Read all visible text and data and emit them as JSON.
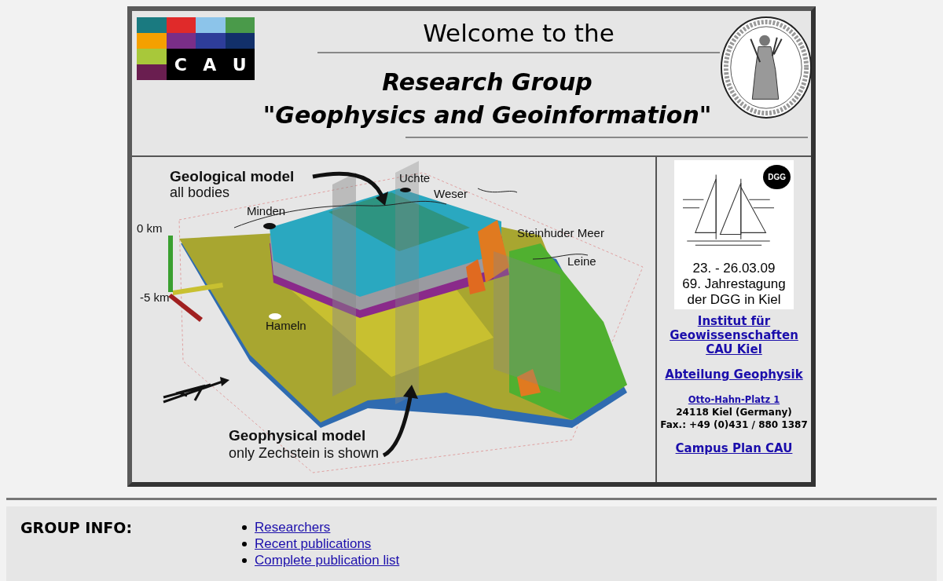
{
  "header": {
    "logo_letters": [
      "C",
      "A",
      "U"
    ],
    "welcome": "Welcome to the",
    "title_lines": [
      "Research Group",
      "\"Geophysics and Geoinformation\""
    ]
  },
  "model_image": {
    "labels": [
      {
        "kind": "heading",
        "text": "Geological model"
      },
      {
        "kind": "caption",
        "text": "all bodies"
      },
      {
        "kind": "place",
        "text": "Uchte"
      },
      {
        "kind": "place",
        "text": "Weser"
      },
      {
        "kind": "place",
        "text": "Minden"
      },
      {
        "kind": "axis",
        "text": "0 km"
      },
      {
        "kind": "place",
        "text": "Steinhuder Meer"
      },
      {
        "kind": "place",
        "text": "Leine"
      },
      {
        "kind": "axis",
        "text": "-5 km"
      },
      {
        "kind": "place",
        "text": "Hameln"
      },
      {
        "kind": "heading",
        "text": "Geophysical model"
      },
      {
        "kind": "caption",
        "text": "only Zechstein is shown"
      }
    ]
  },
  "sidebar": {
    "poster": {
      "logo_text": "DGG",
      "lines": [
        "23. - 26.03.09",
        "69. Jahrestagung",
        "der DGG in Kiel"
      ]
    },
    "items": [
      {
        "kind": "link",
        "text": "Institut für Geowissenschaften CAU Kiel"
      },
      {
        "kind": "link",
        "text": "Abteilung Geophysik"
      },
      {
        "kind": "small-link",
        "text": "Otto-Hahn-Platz 1"
      },
      {
        "kind": "address",
        "text": "24118 Kiel (Germany)"
      },
      {
        "kind": "address",
        "text": "Fax.: +49 (0)431 / 880 1387"
      },
      {
        "kind": "link",
        "text": "Campus Plan CAU"
      }
    ]
  },
  "group_info": {
    "heading": "GROUP INFO:",
    "links": [
      "Researchers",
      "Recent publications",
      "Complete publication list"
    ]
  }
}
